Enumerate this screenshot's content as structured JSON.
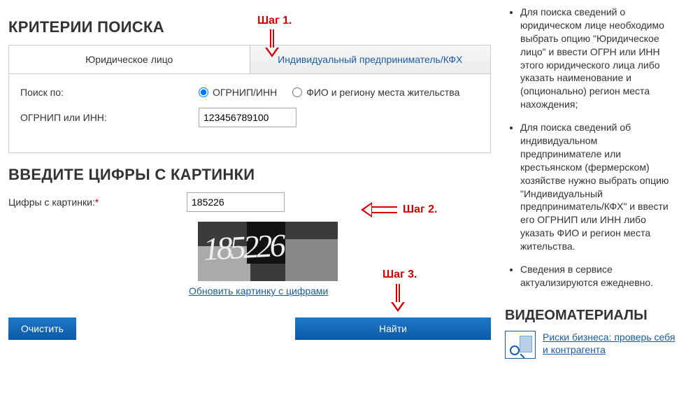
{
  "criteria": {
    "title": "КРИТЕРИИ ПОИСКА",
    "tabs": {
      "legal": "Юридическое лицо",
      "individual": "Индивидуальный предприниматель/КФХ"
    },
    "search_by_label": "Поиск по:",
    "radio_ogrnip": "ОГРНИП/ИНН",
    "radio_fio": "ФИО и региону места жительства",
    "ogrnip_label": "ОГРНИП или ИНН:",
    "ogrnip_value": "123456789100"
  },
  "captcha": {
    "title": "ВВЕДИТЕ ЦИФРЫ С КАРТИНКИ",
    "field_label": "Цифры с картинки:",
    "required_marker": "*",
    "field_value": "185226",
    "image_digits": "185226",
    "refresh_label": "Обновить картинку с цифрами"
  },
  "buttons": {
    "clear": "Очистить",
    "find": "Найти"
  },
  "sidebar": {
    "items": [
      "Для поиска сведений о юридическом лице необходимо выбрать опцию \"Юридическое лицо\" и ввести ОГРН или ИНН этого юридического лица либо указать наименование и (опционально) регион места нахождения;",
      "Для поиска сведений об индивидуальном предпринимателе или крестьянском (фермерском) хозяйстве нужно выбрать опцию \"Индивидуальный предприниматель/КФХ\" и ввести его ОГРНИП или ИНН либо указать ФИО и регион места жительства.",
      "Сведения в сервисе актуализируются ежедневно."
    ],
    "video_title": "ВИДЕОМАТЕРИАЛЫ",
    "video_link": "Риски бизнеса: проверь себя и контрагента"
  },
  "annotations": {
    "step1": "Шаг 1.",
    "step2": "Шаг 2.",
    "step3": "Шаг 3."
  }
}
